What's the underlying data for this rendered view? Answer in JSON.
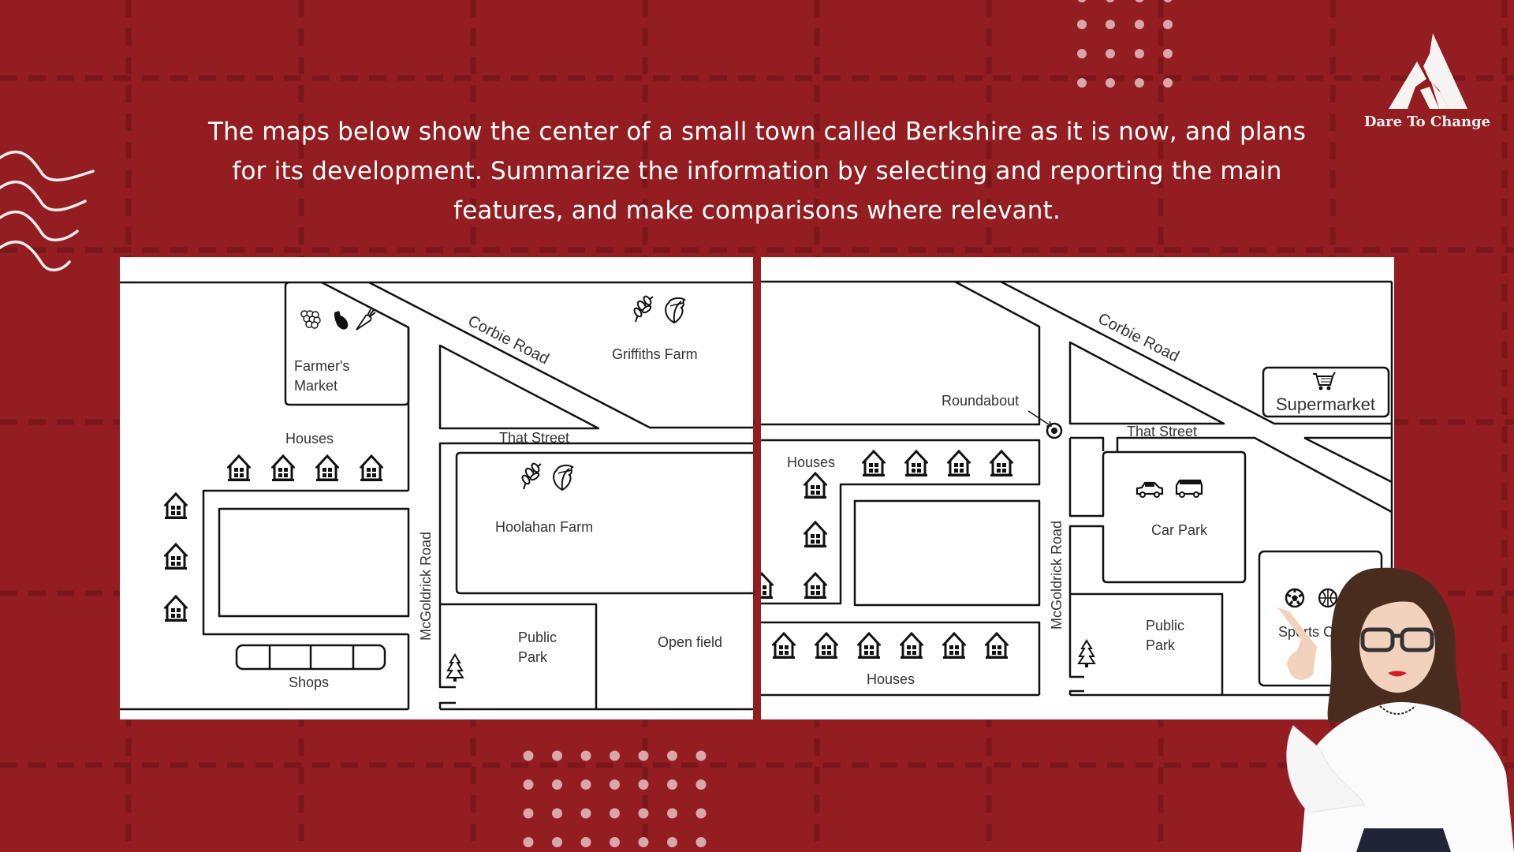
{
  "prompt": {
    "line1": "The maps below show the center of a small town called Berkshire as it is now, and plans",
    "line2": "for its development. Summarize the information by selecting and reporting the main",
    "line3": "features, and make comparisons where relevant."
  },
  "brand": {
    "name": "Dare To Change",
    "logo_icon": "stylized-triangle-A-logo"
  },
  "colors": {
    "background": "#931d21",
    "grid_line": "#7a171a",
    "dot": "#d9a7a9",
    "map_bg": "#ffffff",
    "map_line": "#111111",
    "text": "#ffffff"
  },
  "map_now": {
    "roads": {
      "corbie": "Corbie Road",
      "that_street": "That Street",
      "mcgoldrick": "McGoldrick Road"
    },
    "places": {
      "farmers_market_1": "Farmer's",
      "farmers_market_2": "Market",
      "griffiths_farm": "Griffiths Farm",
      "houses": "Houses",
      "hoolahan_farm": "Hoolahan Farm",
      "public_park_1": "Public",
      "public_park_2": "Park",
      "open_field": "Open field",
      "shops": "Shops"
    },
    "icons": [
      "grapes-icon",
      "eggplant-icon",
      "carrot-icon",
      "wheat-icon",
      "lettuce-icon",
      "house-icon",
      "tree-icon"
    ]
  },
  "map_future": {
    "roads": {
      "corbie": "Corbie Road",
      "that_street": "That Street",
      "mcgoldrick": "McGoldrick Road"
    },
    "places": {
      "roundabout": "Roundabout",
      "supermarket": "Supermarket",
      "houses_top": "Houses",
      "houses_bottom": "Houses",
      "car_park": "Car Park",
      "public_park_1": "Public",
      "public_park_2": "Park",
      "sports_center": "Sports Center"
    },
    "icons": [
      "shopping-cart-icon",
      "car-icon",
      "van-icon",
      "soccer-ball-icon",
      "basketball-icon",
      "baseball-icon",
      "house-icon",
      "tree-icon"
    ]
  },
  "presenter": {
    "description": "woman with glasses in white blouse pointing up"
  }
}
